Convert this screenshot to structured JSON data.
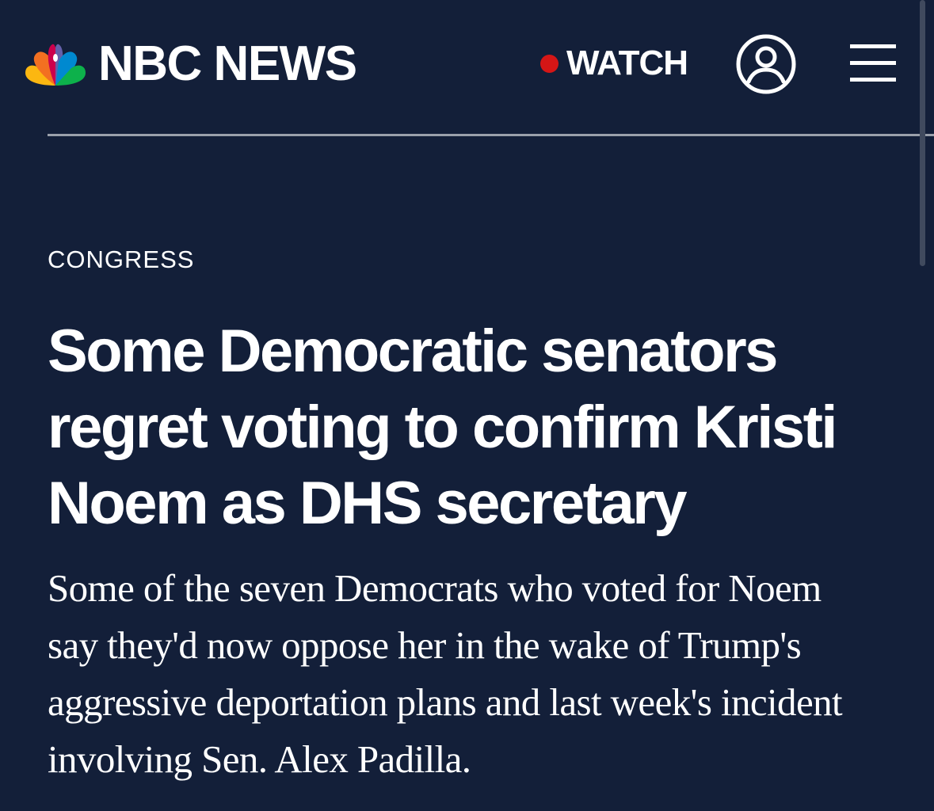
{
  "header": {
    "logo_text": "NBC NEWS",
    "watch_label": "WATCH",
    "live_dot_color": "#d51616",
    "account_icon": "user-circle-icon",
    "menu_icon": "hamburger-menu-icon"
  },
  "article": {
    "section": "CONGRESS",
    "headline_lines": [
      "Some Democratic senators",
      "regret voting to confirm Kristi",
      "Noem as DHS secretary"
    ],
    "dek_lines": [
      "Some of the seven Democrats who voted for Noem",
      "say they'd now oppose her in the wake of Trump's",
      "aggressive deportation plans and last week's incident",
      "involving Sen. Alex Padilla."
    ]
  },
  "colors": {
    "background": "#131f39",
    "text": "#ffffff",
    "divider": "#9aa0ab",
    "peacock": [
      "#fcb711",
      "#f37021",
      "#cc004c",
      "#6460aa",
      "#0089d0",
      "#0db14b"
    ]
  }
}
